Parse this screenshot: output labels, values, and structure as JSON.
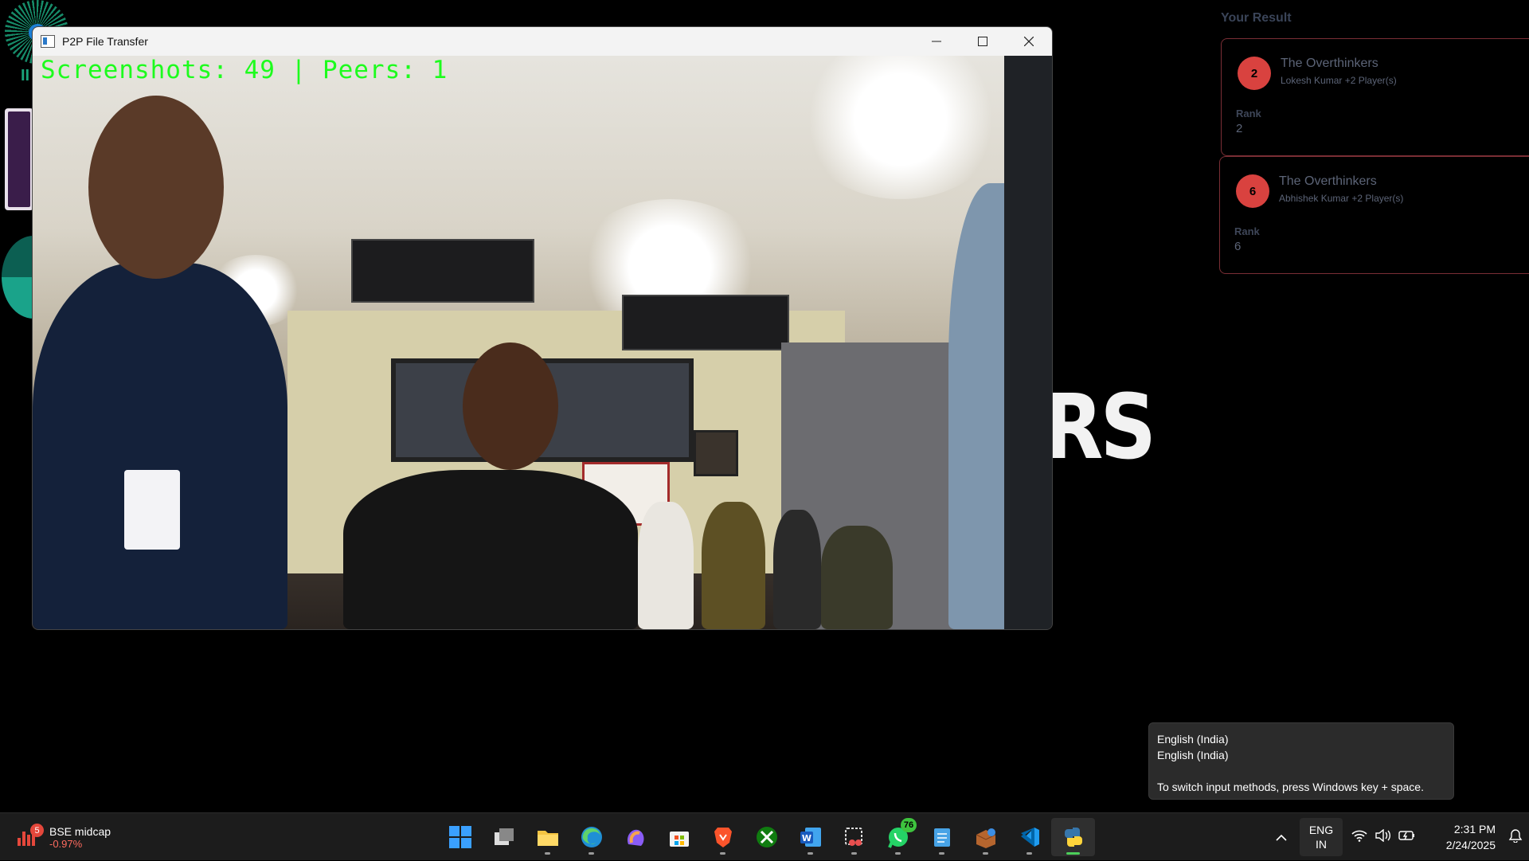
{
  "background": {
    "results_title": "Your Result",
    "results": [
      {
        "rank_badge": "2",
        "team": "The Overthinkers",
        "players": "Lokesh Kumar +2 Player(s)",
        "rank_label": "Rank",
        "rank_value": "2"
      },
      {
        "rank_badge": "6",
        "team": "The Overthinkers",
        "players": "Abhishek Kumar +2 Player(s)",
        "rank_label": "Rank",
        "rank_value": "6"
      }
    ],
    "big_text": "RS"
  },
  "window": {
    "title": "P2P File Transfer",
    "overlay": "Screenshots: 49 | Peers: 1",
    "controls": [
      "minimize",
      "maximize",
      "close"
    ]
  },
  "tooltip": {
    "line1": "English (India)",
    "line2": "English (India)",
    "line3": "To switch input methods, press Windows key + space."
  },
  "taskbar": {
    "widget": {
      "badge": "5",
      "name": "BSE midcap",
      "change": "-0.97%",
      "color": "#e4473b"
    },
    "apps": [
      {
        "name": "start",
        "icon": "windows-icon",
        "running": false
      },
      {
        "name": "task-view",
        "icon": "task-view-icon",
        "running": false
      },
      {
        "name": "file-explorer",
        "icon": "folder-icon",
        "running": true
      },
      {
        "name": "edge",
        "icon": "edge-icon",
        "running": true
      },
      {
        "name": "copilot",
        "icon": "copilot-icon",
        "running": false
      },
      {
        "name": "microsoft-store",
        "icon": "store-icon",
        "running": false
      },
      {
        "name": "brave",
        "icon": "brave-icon",
        "running": true
      },
      {
        "name": "xbox",
        "icon": "xbox-icon",
        "running": false
      },
      {
        "name": "word",
        "icon": "word-icon",
        "running": true
      },
      {
        "name": "snipping-tool",
        "icon": "snipping-icon",
        "running": true
      },
      {
        "name": "whatsapp",
        "icon": "whatsapp-icon",
        "running": true,
        "badge": "76"
      },
      {
        "name": "notepad",
        "icon": "notepad-icon",
        "running": true
      },
      {
        "name": "app-installer",
        "icon": "package-icon",
        "running": true
      },
      {
        "name": "vscode",
        "icon": "vscode-icon",
        "running": true
      },
      {
        "name": "python",
        "icon": "python-icon",
        "running": true,
        "active": true
      }
    ],
    "tray": {
      "lang_line1": "ENG",
      "lang_line2": "IN",
      "time": "2:31 PM",
      "date": "2/24/2025"
    }
  }
}
